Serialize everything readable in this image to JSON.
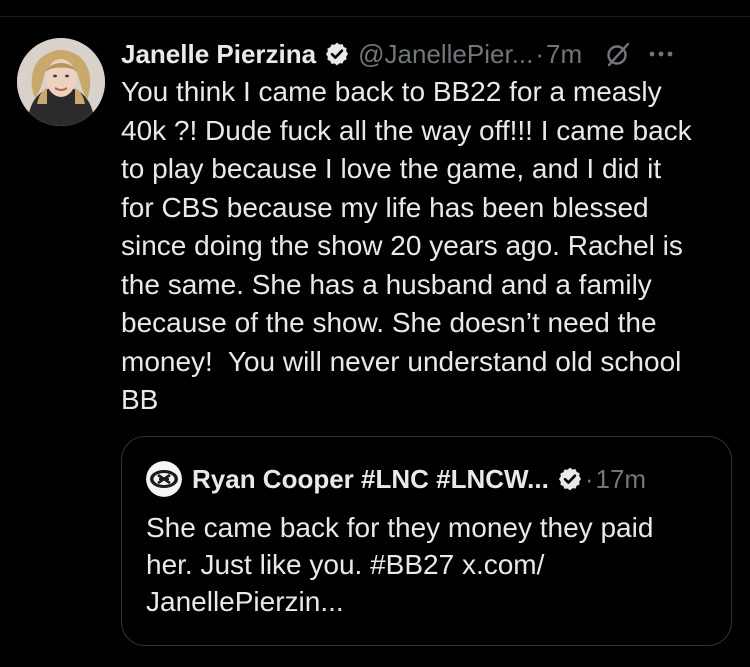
{
  "colors": {
    "background": "#000000",
    "primary_text": "#e7e9ea",
    "secondary_text": "#71767b",
    "border": "#2f3336",
    "verified_badge": "#e7e9ea"
  },
  "tweet": {
    "author": {
      "name": "Janelle Pierzina",
      "handle": "@JanellePier...",
      "verified": true,
      "avatar_icon": "profile-photo"
    },
    "separator": " · ",
    "time": "7m",
    "text": "You think I came back to BB22 for a measly\n40k ?! Dude fuck all the way off!!! I came back\nto play because I love the game, and I did it\nfor CBS because my life has been blessed\nsince doing the show 20 years ago. Rachel is\nthe same. She has a husband and a family\nbecause of the show. She doesn’t need the\nmoney!  You will never understand old school\nBB",
    "icons": [
      "grok-icon",
      "more-icon",
      "verified-icon"
    ]
  },
  "quoted_tweet": {
    "author": {
      "name": "Ryan Cooper #LNC #LNCW...",
      "verified": true,
      "avatar_icon": "chiefs-logo-avatar"
    },
    "separator": " · ",
    "time": "17m",
    "text": "She came back for they money they paid\nher. Just like you. #BB27 x.com/\nJanellePierzin..."
  }
}
